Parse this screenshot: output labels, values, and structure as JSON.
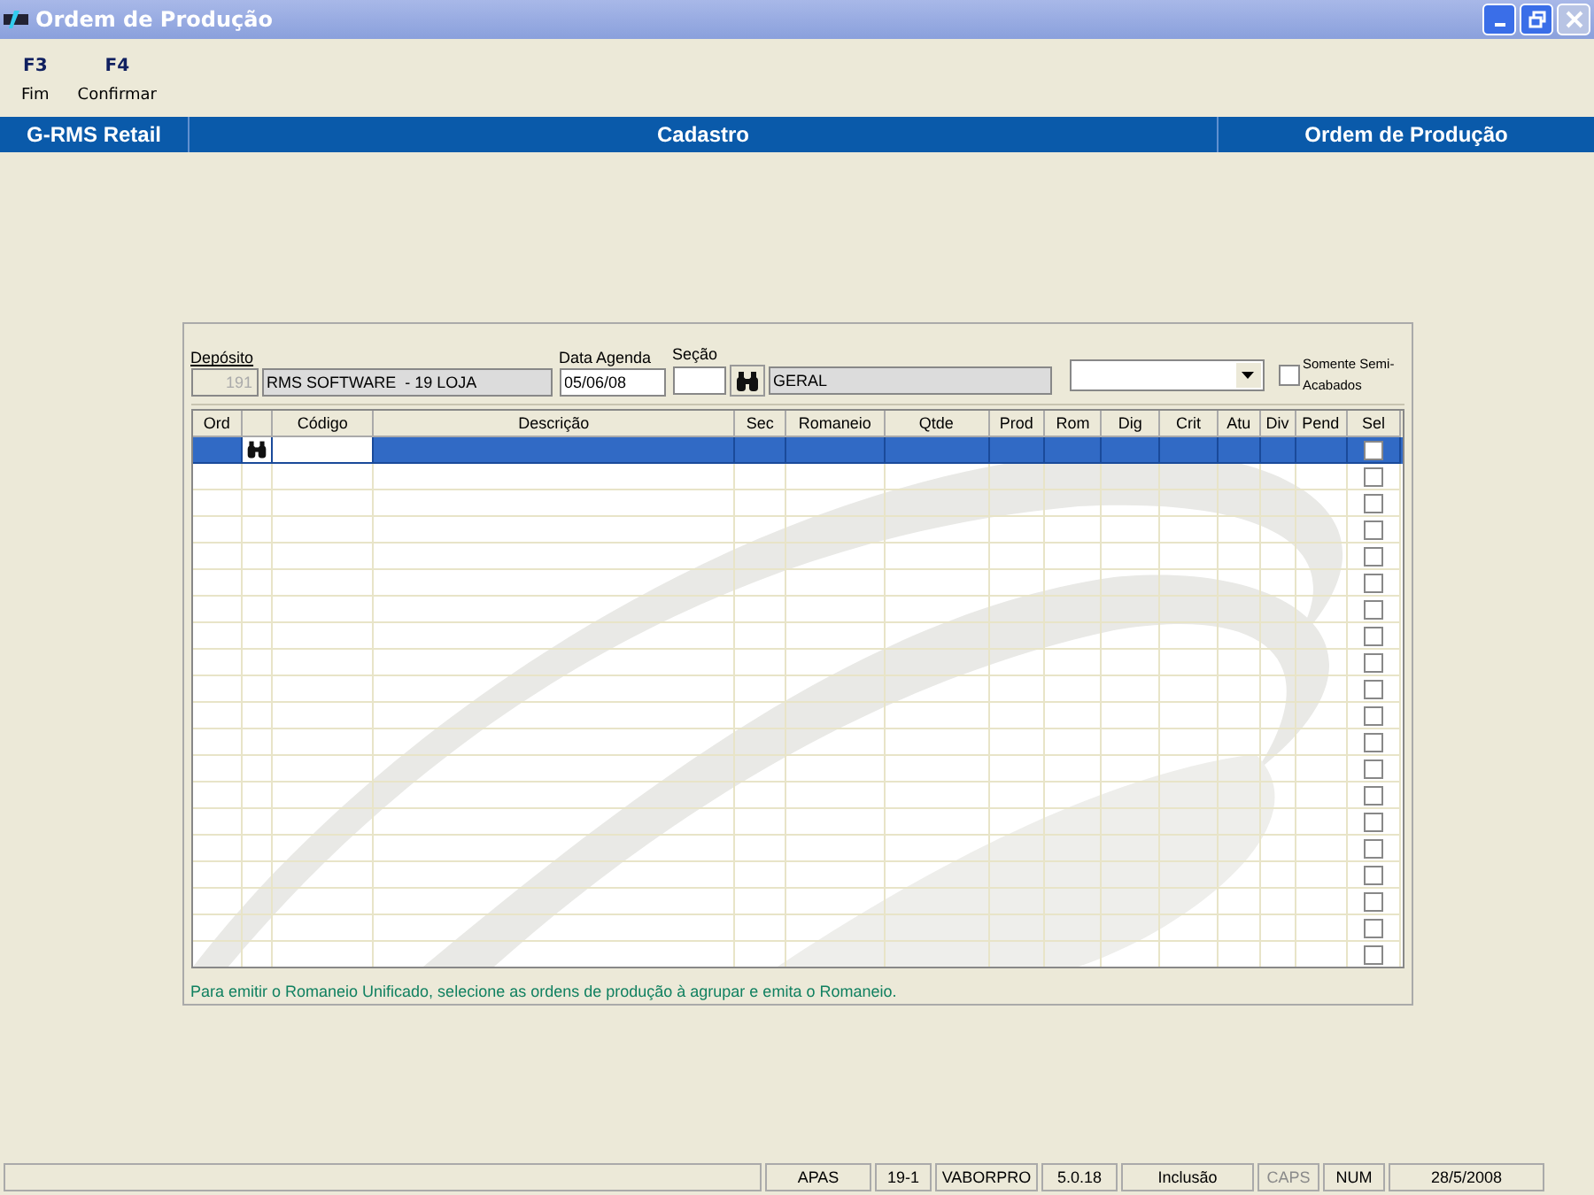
{
  "window": {
    "title": "Ordem de Produção"
  },
  "toolbar": [
    {
      "key": "F3",
      "label": "Fim"
    },
    {
      "key": "F4",
      "label": "Confirmar"
    }
  ],
  "header": {
    "system": "G-RMS Retail",
    "module": "Cadastro",
    "screen": "Ordem de Produção"
  },
  "filters": {
    "deposito_label": "Depósito",
    "deposito_code": "191",
    "deposito_name": "RMS SOFTWARE  - 19 LOJA",
    "data_label": "Data Agenda",
    "data_value": "05/06/08",
    "secao_label": "Seção",
    "secao_name": "GERAL",
    "somente_label": "Somente Semi-Acabados",
    "somente_checked": false
  },
  "table": {
    "columns": [
      "Ord",
      "",
      "Código",
      "Descrição",
      "Sec",
      "Romaneio",
      "Qtde",
      "Prod",
      "Rom",
      "Dig",
      "Crit",
      "Atu",
      "Div",
      "Pend",
      "Sel"
    ],
    "rows": [
      {
        "selected": true,
        "checked": false
      },
      {
        "selected": false,
        "checked": false
      },
      {
        "selected": false,
        "checked": false
      },
      {
        "selected": false,
        "checked": false
      },
      {
        "selected": false,
        "checked": false
      },
      {
        "selected": false,
        "checked": false
      },
      {
        "selected": false,
        "checked": false
      },
      {
        "selected": false,
        "checked": false
      },
      {
        "selected": false,
        "checked": false
      },
      {
        "selected": false,
        "checked": false
      },
      {
        "selected": false,
        "checked": false
      },
      {
        "selected": false,
        "checked": false
      },
      {
        "selected": false,
        "checked": false
      },
      {
        "selected": false,
        "checked": false
      },
      {
        "selected": false,
        "checked": false
      },
      {
        "selected": false,
        "checked": false
      },
      {
        "selected": false,
        "checked": false
      },
      {
        "selected": false,
        "checked": false
      },
      {
        "selected": false,
        "checked": false
      },
      {
        "selected": false,
        "checked": false
      }
    ]
  },
  "hint": "Para emitir o Romaneio Unificado, selecione as ordens de produção à agrupar e emita o Romaneio.",
  "status_bar": [
    {
      "text": "APAS",
      "disabled": false
    },
    {
      "text": "19-1",
      "disabled": false
    },
    {
      "text": "VABORPRO",
      "disabled": false
    },
    {
      "text": "5.0.18",
      "disabled": false
    },
    {
      "text": "Inclusão",
      "disabled": false
    },
    {
      "text": "CAPS",
      "disabled": true
    },
    {
      "text": "NUM",
      "disabled": false
    },
    {
      "text": "28/5/2008",
      "disabled": false
    }
  ]
}
